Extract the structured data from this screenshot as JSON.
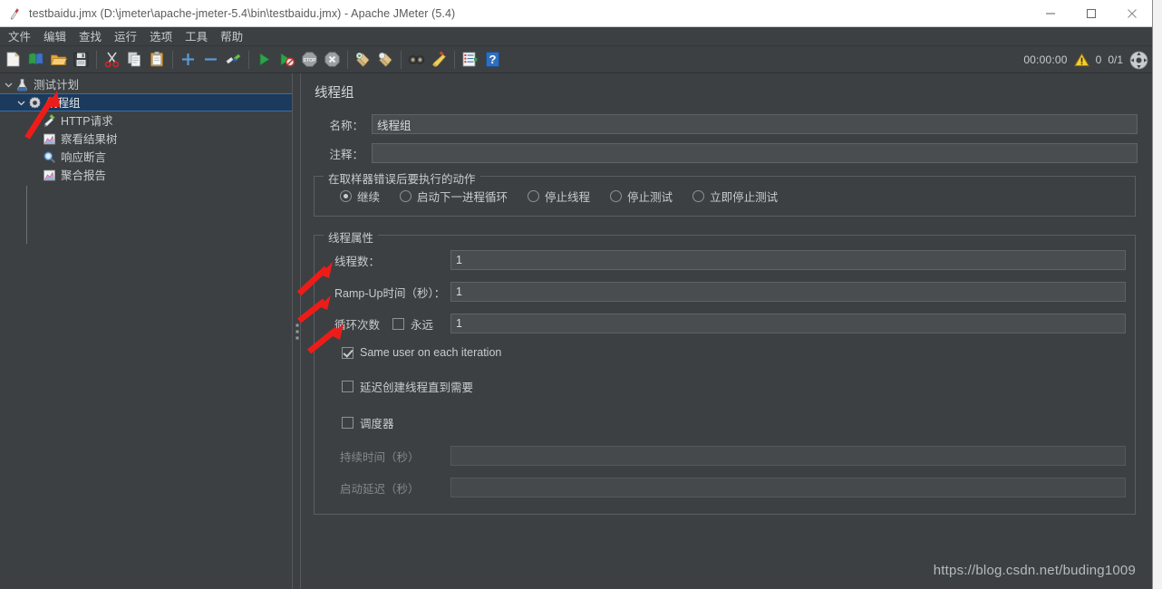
{
  "window": {
    "title": "testbaidu.jmx (D:\\jmeter\\apache-jmeter-5.4\\bin\\testbaidu.jmx) - Apache JMeter (5.4)",
    "app_icon": "jmeter-feather-icon",
    "controls": {
      "minimize": "minimize-icon",
      "maximize": "maximize-icon",
      "close": "close-icon"
    }
  },
  "menubar": {
    "items": [
      {
        "label": "文件"
      },
      {
        "label": "编辑"
      },
      {
        "label": "查找"
      },
      {
        "label": "运行"
      },
      {
        "label": "选项"
      },
      {
        "label": "工具"
      },
      {
        "label": "帮助"
      }
    ]
  },
  "toolbar": {
    "buttons": [
      {
        "name": "new-icon",
        "title": "新建"
      },
      {
        "name": "templates-icon",
        "title": "模板"
      },
      {
        "name": "open-icon",
        "title": "打开"
      },
      {
        "name": "save-icon",
        "title": "保存"
      },
      {
        "name": "cut-icon",
        "title": "剪切"
      },
      {
        "name": "copy-icon",
        "title": "复制"
      },
      {
        "name": "paste-icon",
        "title": "粘贴"
      },
      {
        "name": "expand-all-icon",
        "title": "展开全部"
      },
      {
        "name": "collapse-all-icon",
        "title": "收起全部"
      },
      {
        "name": "toggle-icon",
        "title": "启用/禁用"
      },
      {
        "name": "start-icon",
        "title": "启动"
      },
      {
        "name": "start-no-pauses-icon",
        "title": "无间隔启动"
      },
      {
        "name": "stop-icon",
        "title": "停止"
      },
      {
        "name": "shutdown-icon",
        "title": "关闭"
      },
      {
        "name": "clear-icon",
        "title": "清除"
      },
      {
        "name": "clear-all-icon",
        "title": "清除全部"
      },
      {
        "name": "search-icon",
        "title": "查找"
      },
      {
        "name": "reset-search-icon",
        "title": "重置查找"
      },
      {
        "name": "function-helper-icon",
        "title": "函数助手对话框"
      },
      {
        "name": "help-icon",
        "title": "帮助"
      }
    ],
    "status": {
      "elapsed_time": "00:00:00",
      "warning_icon": "warning-triangle-icon",
      "error_count": "0",
      "thread_count": "0/1",
      "remote_icon": "remote-engines-icon"
    }
  },
  "tree": {
    "nodes": [
      {
        "label": "测试计划",
        "icon": "test-plan-icon",
        "depth": 0,
        "twisty": "collapse",
        "selected": false
      },
      {
        "label": "线程组",
        "icon": "thread-group-icon",
        "depth": 1,
        "twisty": "collapse",
        "selected": true
      },
      {
        "label": "HTTP请求",
        "icon": "http-request-icon",
        "depth": 2,
        "twisty": "none",
        "selected": false
      },
      {
        "label": "察看结果树",
        "icon": "view-results-tree-icon",
        "depth": 2,
        "twisty": "none",
        "selected": false
      },
      {
        "label": "响应断言",
        "icon": "response-assertion-icon",
        "depth": 2,
        "twisty": "none",
        "selected": false
      },
      {
        "label": "聚合报告",
        "icon": "aggregate-report-icon",
        "depth": 2,
        "twisty": "none",
        "selected": false
      }
    ]
  },
  "panel": {
    "title": "线程组",
    "name_label": "名称：",
    "name_value": "线程组",
    "comment_label": "注释：",
    "comment_value": "",
    "error_action": {
      "group_title": "在取样器错误后要执行的动作",
      "options": [
        {
          "label": "继续",
          "selected": true
        },
        {
          "label": "启动下一进程循环",
          "selected": false
        },
        {
          "label": "停止线程",
          "selected": false
        },
        {
          "label": "停止测试",
          "selected": false
        },
        {
          "label": "立即停止测试",
          "selected": false
        }
      ]
    },
    "thread_properties": {
      "group_title": "线程属性",
      "threads_label": "线程数：",
      "threads_value": "1",
      "rampup_label": "Ramp-Up时间（秒）：",
      "rampup_value": "1",
      "loops_label": "循环次数",
      "forever_label": "永远",
      "forever_checked": false,
      "loops_value": "1",
      "same_user_label": "Same user on each iteration",
      "same_user_checked": true,
      "delayed_start_label": "延迟创建线程直到需要",
      "delayed_start_checked": false,
      "scheduler_label": "调度器",
      "scheduler_checked": false,
      "duration_label": "持续时间（秒）",
      "duration_value": "",
      "duration_disabled": true,
      "startup_delay_label": "启动延迟（秒）",
      "startup_delay_value": "",
      "startup_delay_disabled": true
    }
  },
  "watermark": {
    "text": "https://blog.csdn.net/buding1009"
  },
  "annotations": {
    "arrow_color": "#ee1c18",
    "arrows": [
      {
        "name": "arrow-to-thread-group",
        "points_at": "线程组"
      },
      {
        "name": "arrow-to-thread-count",
        "points_at": "线程数："
      },
      {
        "name": "arrow-to-rampup",
        "points_at": "Ramp-Up时间（秒）："
      },
      {
        "name": "arrow-to-loop-count",
        "points_at": "循环次数"
      }
    ]
  },
  "colors": {
    "window_bg": "#3c4043",
    "titlebar_bg": "#ffffff",
    "selection_bg": "#1b3a5c",
    "text": "#c9ccce",
    "input_bg": "#494d50",
    "annotation_red": "#ee1c18"
  }
}
